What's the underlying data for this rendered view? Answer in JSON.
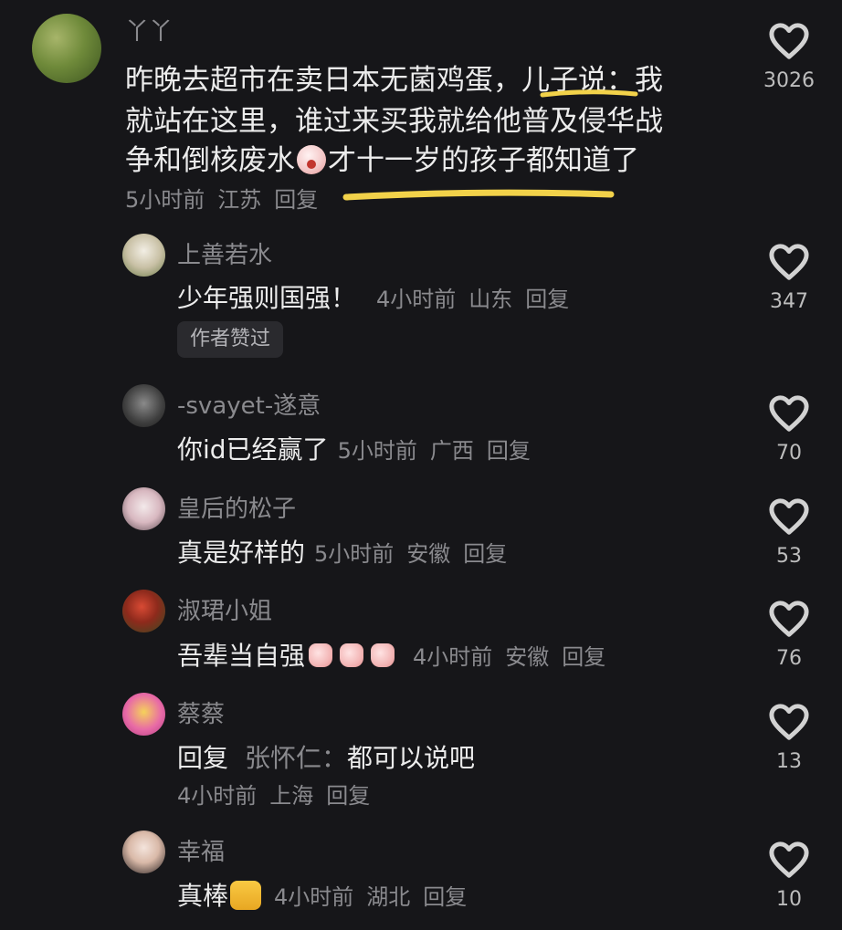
{
  "comments": [
    {
      "username": "丫丫",
      "text_lines": [
        "昨晚去超市在卖日本无菌鸡蛋，儿子说：我",
        "就站在这里，谁过来买我就给他普及侵华战",
        "争和倒核废水",
        "才十一岁的孩子都知道了"
      ],
      "time": "5小时前",
      "location": "江苏",
      "reply_label": "回复",
      "likes": "3026",
      "colors": {
        "highlight": "#f2d24a"
      }
    },
    {
      "username": "上善若水",
      "text": "少年强则国强！",
      "time": "4小时前",
      "location": "山东",
      "reply_label": "回复",
      "chip": "作者赞过",
      "likes": "347"
    },
    {
      "username": "-svayet-遂意",
      "text": "你id已经赢了",
      "time": "5小时前",
      "location": "广西",
      "reply_label": "回复",
      "likes": "70"
    },
    {
      "username": "皇后的松子",
      "text": "真是好样的",
      "time": "5小时前",
      "location": "安徽",
      "reply_label": "回复",
      "likes": "53"
    },
    {
      "username": "淑珺小姐",
      "text": "吾辈当自强",
      "time": "4小时前",
      "location": "安徽",
      "reply_label": "回复",
      "likes": "76"
    },
    {
      "username": "蔡蔡",
      "reply_prefix": "回复",
      "reply_to": "张怀仁：",
      "text": "都可以说吧",
      "time": "4小时前",
      "location": "上海",
      "reply_label": "回复",
      "likes": "13"
    },
    {
      "username": "幸福",
      "text": "真棒",
      "time": "4小时前",
      "location": "湖北",
      "reply_label": "回复",
      "likes": "10"
    }
  ]
}
